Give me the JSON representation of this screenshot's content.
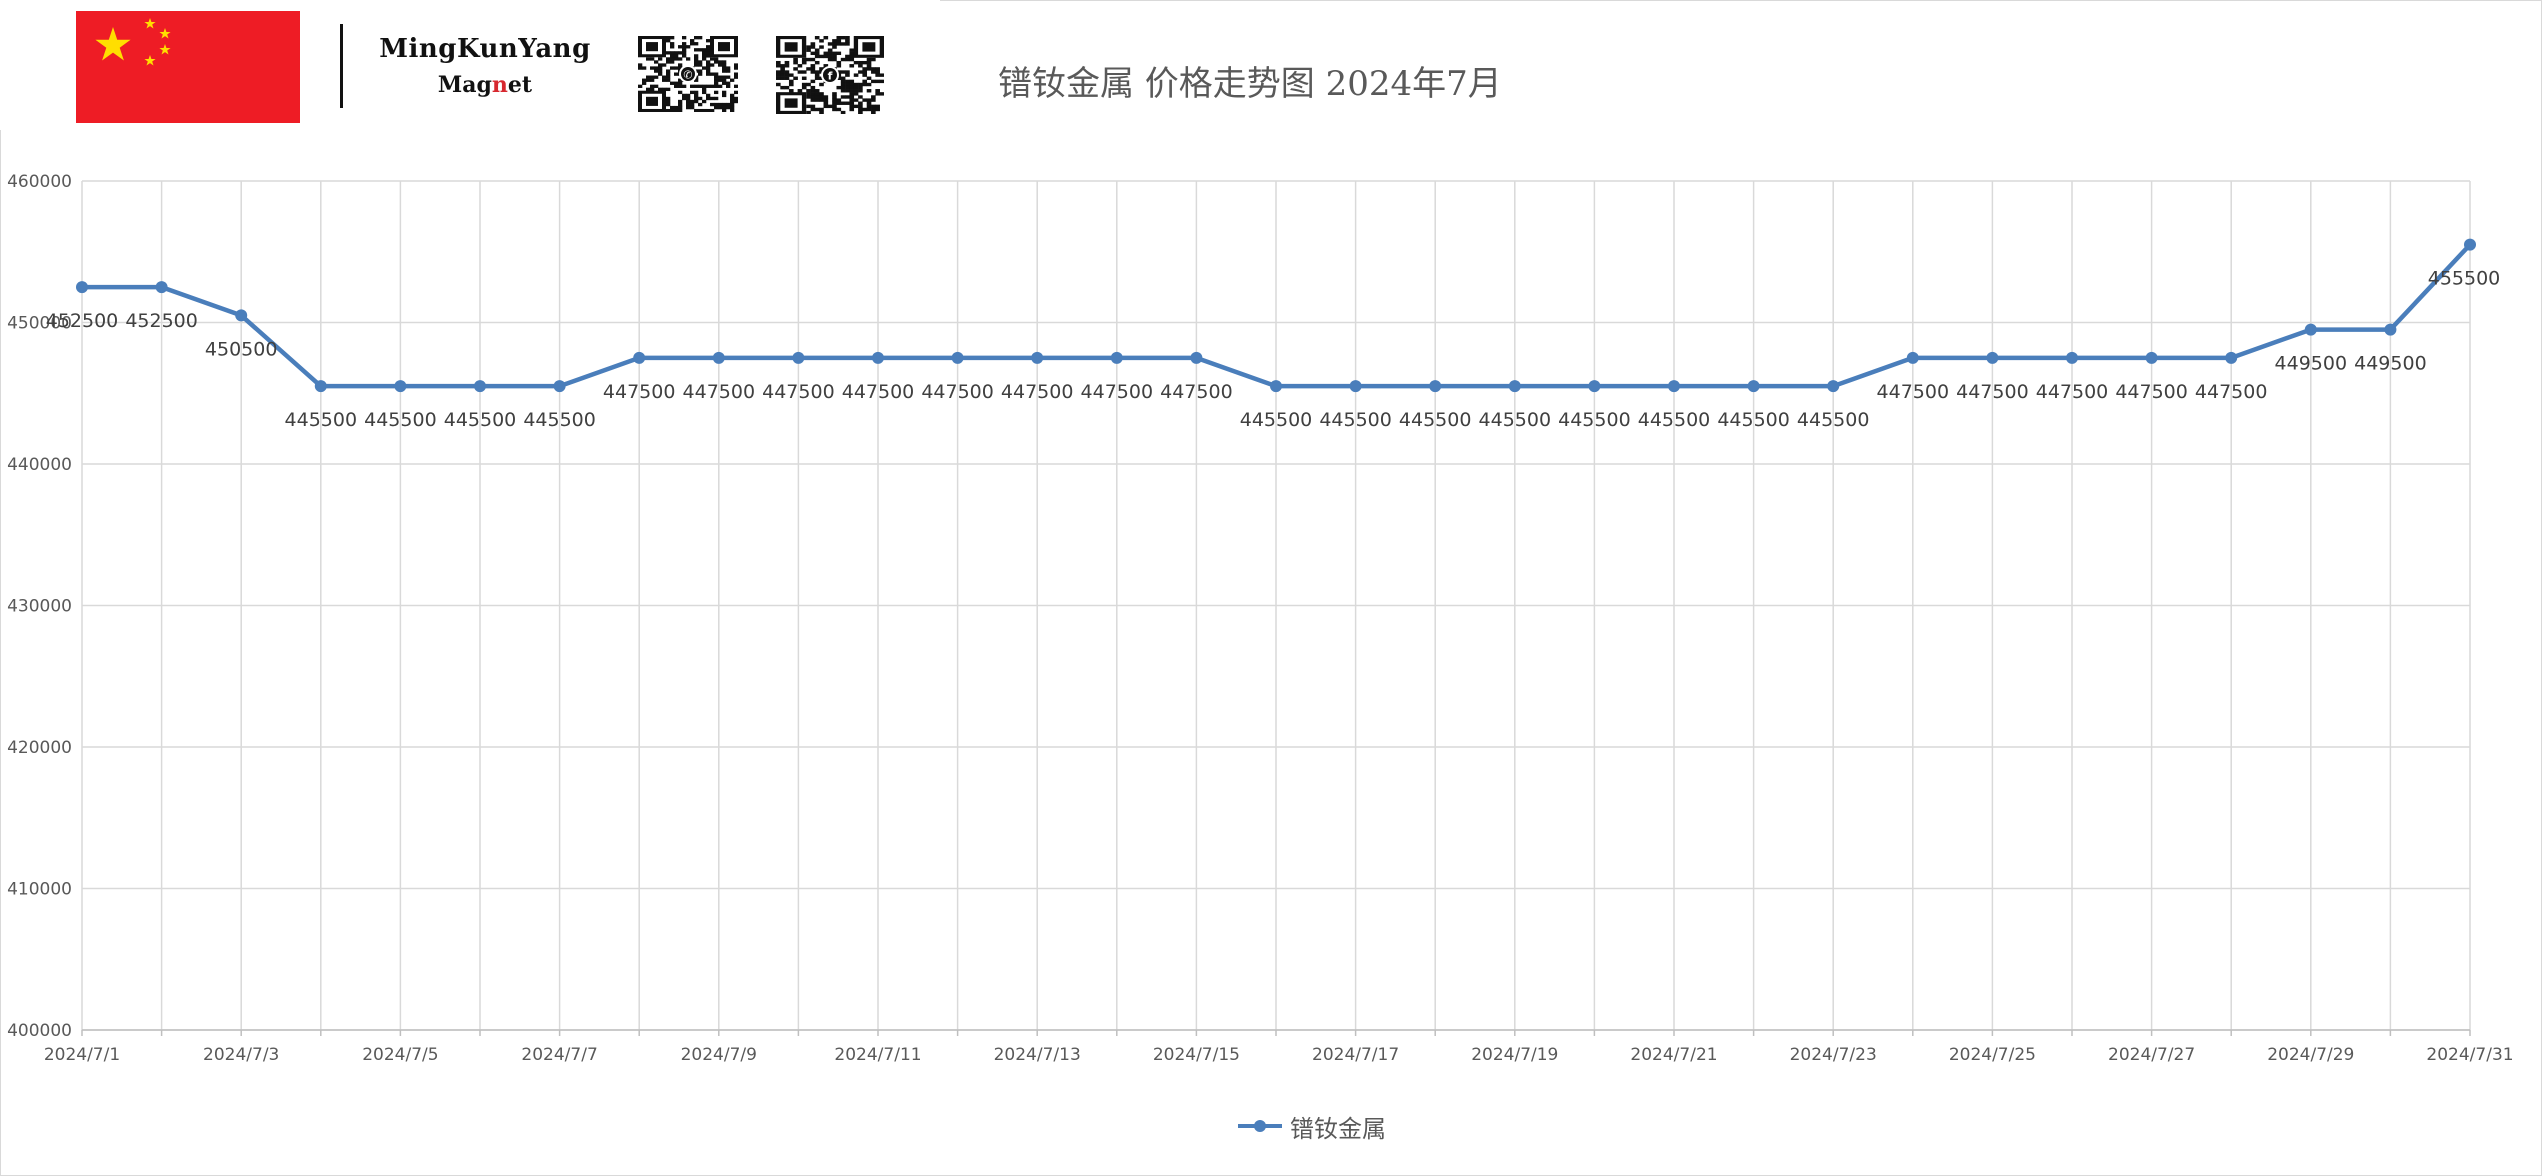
{
  "header": {
    "brand_line1": "MingKunYang",
    "brand_line2_a": "Mag",
    "brand_line2_b": "n",
    "brand_line2_c": "et",
    "flag_color": "#ee1c25",
    "star_color": "#ffde00",
    "icons": [
      "china-flag-icon",
      "whatsapp-qr-icon",
      "facebook-qr-icon"
    ]
  },
  "chart_data": {
    "type": "line",
    "title": "镨钕金属 价格走势图 2024年7月",
    "xlabel": "",
    "ylabel": "",
    "ylim": [
      400000,
      460000
    ],
    "yticks": [
      400000,
      410000,
      420000,
      430000,
      440000,
      450000,
      460000
    ],
    "grid": true,
    "legend_position": "bottom",
    "line_color": "#4a7ebb",
    "x": [
      "2024/7/1",
      "2024/7/2",
      "2024/7/3",
      "2024/7/4",
      "2024/7/5",
      "2024/7/6",
      "2024/7/7",
      "2024/7/8",
      "2024/7/9",
      "2024/7/10",
      "2024/7/11",
      "2024/7/12",
      "2024/7/13",
      "2024/7/14",
      "2024/7/15",
      "2024/7/16",
      "2024/7/17",
      "2024/7/18",
      "2024/7/19",
      "2024/7/20",
      "2024/7/21",
      "2024/7/22",
      "2024/7/23",
      "2024/7/24",
      "2024/7/25",
      "2024/7/26",
      "2024/7/27",
      "2024/7/28",
      "2024/7/29",
      "2024/7/30",
      "2024/7/31"
    ],
    "x_tick_labels": [
      "2024/7/1",
      "2024/7/3",
      "2024/7/5",
      "2024/7/7",
      "2024/7/9",
      "2024/7/11",
      "2024/7/13",
      "2024/7/15",
      "2024/7/17",
      "2024/7/19",
      "2024/7/21",
      "2024/7/23",
      "2024/7/25",
      "2024/7/27",
      "2024/7/29",
      "2024/7/31"
    ],
    "series": [
      {
        "name": "镨钕金属",
        "values": [
          452500,
          452500,
          450500,
          445500,
          445500,
          445500,
          445500,
          447500,
          447500,
          447500,
          447500,
          447500,
          447500,
          447500,
          447500,
          445500,
          445500,
          445500,
          445500,
          445500,
          445500,
          445500,
          445500,
          447500,
          447500,
          447500,
          447500,
          447500,
          449500,
          449500,
          455500
        ]
      }
    ]
  }
}
